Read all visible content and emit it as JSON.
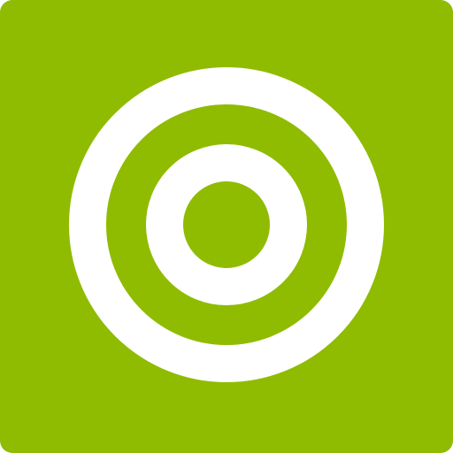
{
  "icon": {
    "name": "target-icon",
    "background_color": "#8fbc00",
    "ring_color": "#ffffff"
  }
}
